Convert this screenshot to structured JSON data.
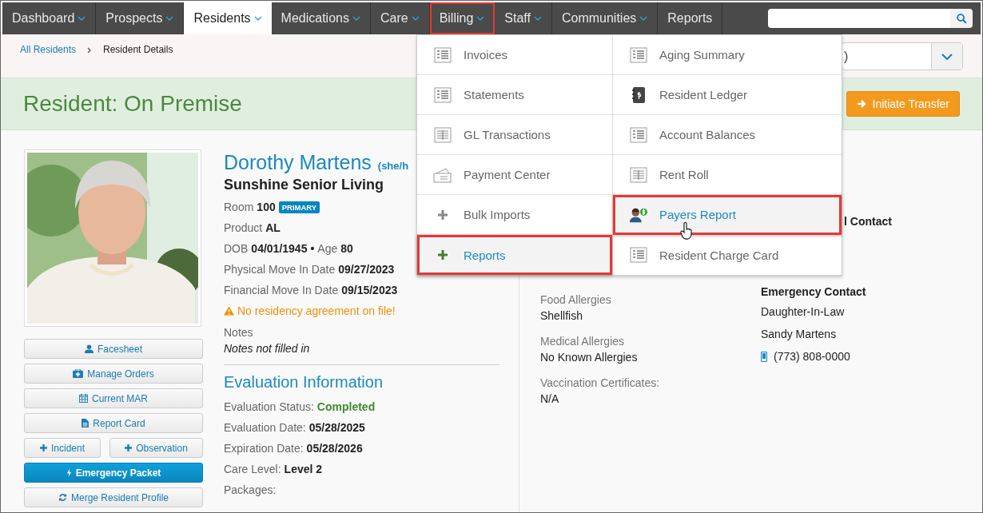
{
  "nav": {
    "items": [
      {
        "label": "Dashboard",
        "has_menu": true,
        "selected": false,
        "highlighted": false
      },
      {
        "label": "Prospects",
        "has_menu": true,
        "selected": false,
        "highlighted": false
      },
      {
        "label": "Residents",
        "has_menu": true,
        "selected": true,
        "highlighted": false
      },
      {
        "label": "Medications",
        "has_menu": true,
        "selected": false,
        "highlighted": false
      },
      {
        "label": "Care",
        "has_menu": true,
        "selected": false,
        "highlighted": false
      },
      {
        "label": "Billing",
        "has_menu": true,
        "selected": false,
        "highlighted": true
      },
      {
        "label": "Staff",
        "has_menu": true,
        "selected": false,
        "highlighted": false
      },
      {
        "label": "Communities",
        "has_menu": true,
        "selected": false,
        "highlighted": false
      },
      {
        "label": "Reports",
        "has_menu": false,
        "selected": false,
        "highlighted": false
      }
    ]
  },
  "breadcrumb": [
    {
      "label": "All Residents",
      "link": true
    },
    {
      "label": "Resident Details",
      "link": false
    }
  ],
  "community_select": {
    "value": ")"
  },
  "banner": {
    "title": "Resident: On Premise",
    "transfer_button": "Initiate Transfer"
  },
  "billing_menu": {
    "columns": [
      [
        {
          "label": "Invoices",
          "kind": "list",
          "highlighted": false,
          "hovered": false
        },
        {
          "label": "Statements",
          "kind": "list",
          "highlighted": false,
          "hovered": false
        },
        {
          "label": "GL Transactions",
          "kind": "table",
          "highlighted": false,
          "hovered": false
        },
        {
          "label": "Payment Center",
          "kind": "cash",
          "highlighted": false,
          "hovered": false
        },
        {
          "label": "Bulk Imports",
          "kind": "plus",
          "highlighted": false,
          "hovered": false
        },
        {
          "label": "Reports",
          "kind": "plus",
          "highlighted": true,
          "hovered": false
        }
      ],
      [
        {
          "label": "Aging Summary",
          "kind": "list",
          "highlighted": false,
          "hovered": false
        },
        {
          "label": "Resident Ledger",
          "kind": "ledger",
          "highlighted": false,
          "hovered": false
        },
        {
          "label": "Account Balances",
          "kind": "list",
          "highlighted": false,
          "hovered": false
        },
        {
          "label": "Rent Roll",
          "kind": "table",
          "highlighted": false,
          "hovered": false
        },
        {
          "label": "Payers Report",
          "kind": "payer",
          "highlighted": true,
          "hovered": true
        },
        {
          "label": "Resident Charge Card",
          "kind": "list",
          "highlighted": false,
          "hovered": false
        }
      ]
    ]
  },
  "profile": {
    "buttons": [
      {
        "label": "Facesheet",
        "kind": "user",
        "primary": false,
        "half": false
      },
      {
        "label": "Manage Orders",
        "kind": "medkit",
        "primary": false,
        "half": false
      },
      {
        "label": "Current MAR",
        "kind": "calendar",
        "primary": false,
        "half": false
      },
      {
        "label": "Report Card",
        "kind": "file",
        "primary": false,
        "half": false
      },
      {
        "label": "Incident",
        "kind": "plus",
        "primary": false,
        "half": true
      },
      {
        "label": "Observation",
        "kind": "plus",
        "primary": false,
        "half": true
      },
      {
        "label": "Emergency Packet",
        "kind": "bolt",
        "primary": true,
        "half": false
      },
      {
        "label": "Merge Resident Profile",
        "kind": "refresh",
        "primary": false,
        "half": false
      }
    ]
  },
  "resident": {
    "name": "Dorothy Martens",
    "pronouns": "(she/h",
    "community": "Sunshine Senior Living",
    "details": [
      {
        "kind": "pairs",
        "parts": [
          {
            "label": "Room",
            "value": "100"
          }
        ],
        "badge": "PRIMARY"
      },
      {
        "kind": "pairs",
        "parts": [
          {
            "label": "Product",
            "value": "AL"
          }
        ]
      },
      {
        "kind": "pairs",
        "parts": [
          {
            "label": "DOB",
            "value": "04/01/1945"
          },
          {
            "label": "Age",
            "value": "80"
          }
        ],
        "separator": "•"
      },
      {
        "kind": "pairs",
        "parts": [
          {
            "label": "Physical Move In Date",
            "value": "09/27/2023"
          }
        ]
      },
      {
        "kind": "pairs",
        "parts": [
          {
            "label": "Financial Move In Date",
            "value": "09/15/2023"
          }
        ]
      },
      {
        "kind": "warning",
        "text": "No residency agreement on file!"
      },
      {
        "kind": "note",
        "label": "Notes",
        "value": "Notes not filled in"
      }
    ]
  },
  "evaluation": {
    "title": "Evaluation Information",
    "rows": [
      {
        "label": "Evaluation Status:",
        "value": "Completed",
        "positive": true
      },
      {
        "label": "Evaluation Date:",
        "value": "05/28/2025",
        "positive": false
      },
      {
        "label": "Expiration Date:",
        "value": "05/28/2026",
        "positive": false
      },
      {
        "label": "Care Level:",
        "value": "Level 2",
        "positive": false
      },
      {
        "label": "Packages:"
      }
    ]
  },
  "health": [
    {
      "label": "Food Allergies",
      "value": "Shellfish"
    },
    {
      "label": "Medical Allergies",
      "value": "No Known Allergies"
    },
    {
      "label": "Vaccination Certificates:",
      "value": "N/A"
    }
  ],
  "contacts": {
    "partial_heading": "l Contact",
    "emergency": {
      "title": "Emergency Contact",
      "relation": "Daughter-In-Law",
      "name": "Sandy Martens",
      "phone": "(773) 808-0000"
    }
  }
}
